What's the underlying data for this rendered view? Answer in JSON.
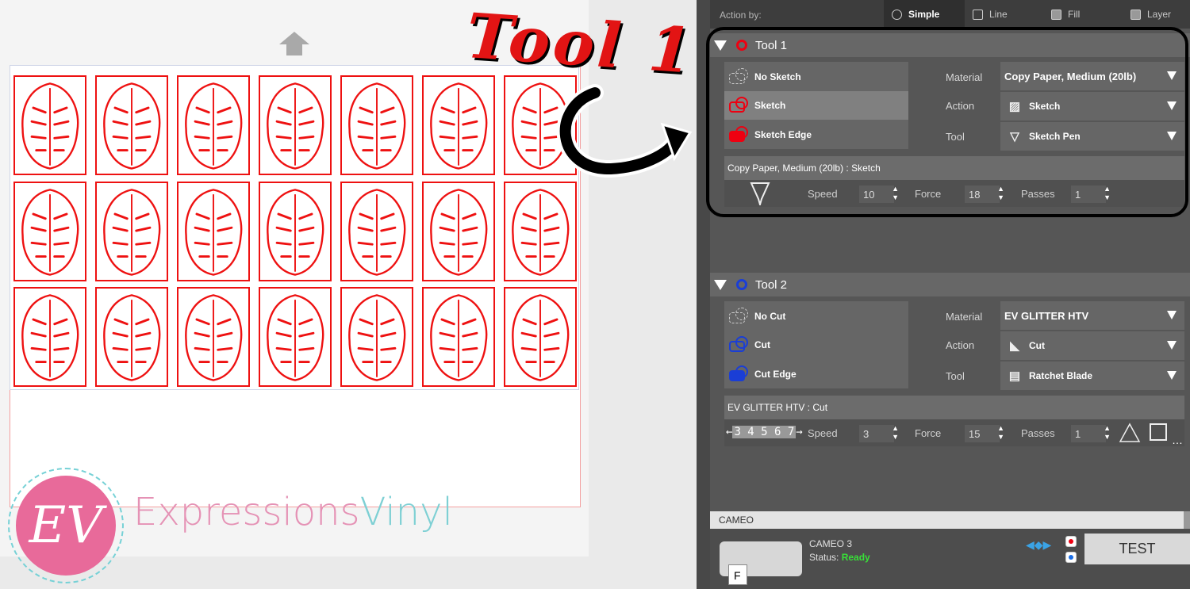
{
  "annotation": {
    "callout_text": "Tool 1"
  },
  "branding": {
    "logo_letters": "EV",
    "name_part1": "Expressions",
    "name_part2": "Vinyl"
  },
  "action_bar": {
    "label": "Action by:",
    "tabs": [
      {
        "label": "Simple",
        "active": true
      },
      {
        "label": "Line",
        "active": false
      },
      {
        "label": "Fill",
        "active": false
      },
      {
        "label": "Layer",
        "active": false
      }
    ]
  },
  "tool1": {
    "title": "Tool 1",
    "color": "#e01010",
    "modes": [
      "No Sketch",
      "Sketch",
      "Sketch Edge"
    ],
    "selected_mode": "Sketch",
    "material_label": "Material",
    "material_value": "Copy Paper, Medium (20lb)",
    "action_label": "Action",
    "action_value": "Sketch",
    "tool_label": "Tool",
    "tool_value": "Sketch Pen",
    "summary": "Copy Paper, Medium (20lb) : Sketch",
    "speed_label": "Speed",
    "speed": "10",
    "force_label": "Force",
    "force": "18",
    "passes_label": "Passes",
    "passes": "1"
  },
  "tool2": {
    "title": "Tool 2",
    "color": "#1a3ed6",
    "modes": [
      "No Cut",
      "Cut",
      "Cut Edge"
    ],
    "material_label": "Material",
    "material_value": "EV GLITTER HTV",
    "action_label": "Action",
    "action_value": "Cut",
    "tool_label": "Tool",
    "tool_value": "Ratchet Blade",
    "summary": "EV GLITTER HTV : Cut",
    "blade_digits": "3 4 5 6 7",
    "speed_label": "Speed",
    "speed": "3",
    "force_label": "Force",
    "force": "15",
    "passes_label": "Passes",
    "passes": "1"
  },
  "status": {
    "section": "CAMEO",
    "machine_name": "CAMEO 3",
    "status_label": "Status:",
    "status_value": "Ready",
    "tray_letter": "F",
    "test_button": "TEST"
  }
}
